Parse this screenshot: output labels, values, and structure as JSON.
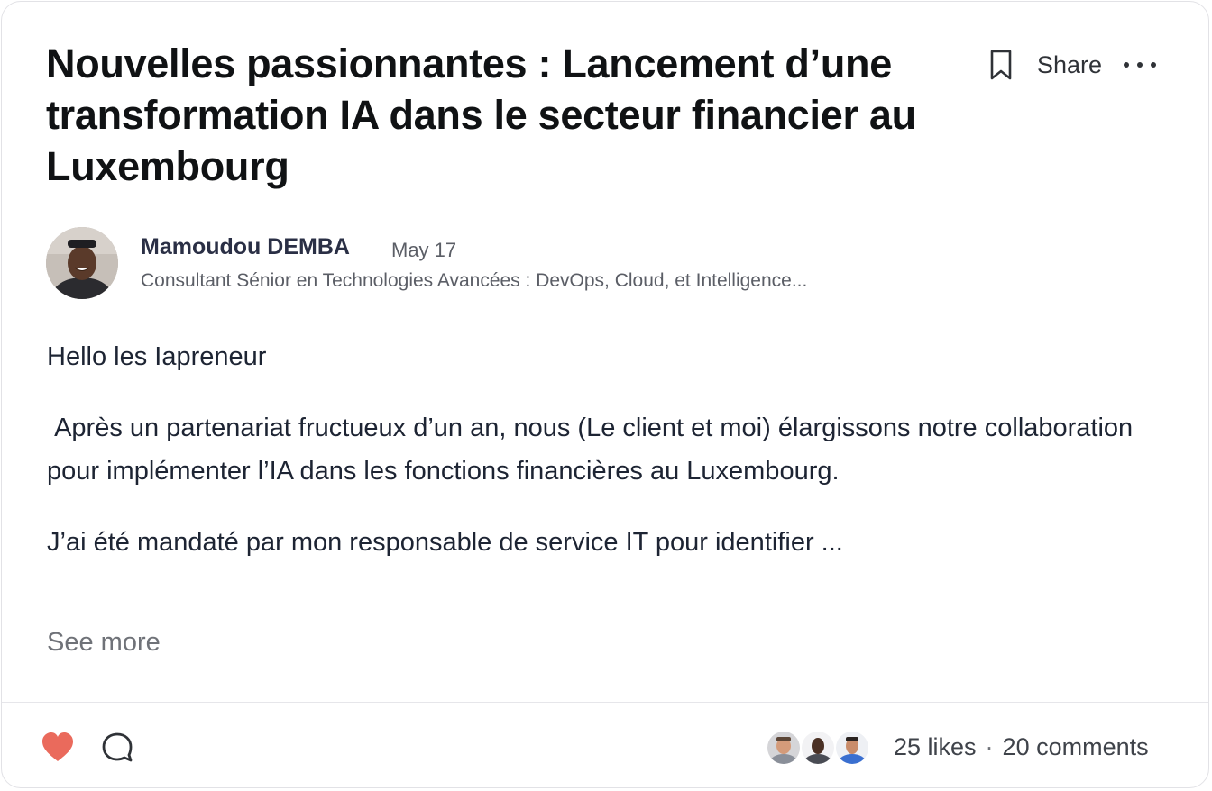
{
  "post": {
    "title": "Nouvelles passionnantes : Lancement d’une transformation IA dans le secteur financier au Luxembourg",
    "share_label": "Share",
    "author": {
      "name": "Mamoudou DEMBA",
      "date": "May 17",
      "headline": "Consultant Sénior en Technologies Avancées : DevOps, Cloud, et Intelligence..."
    },
    "body": [
      "Hello les Iapreneur",
      " Après un partenariat fructueux d’un an, nous (Le client et moi) élargissons notre collaboration pour implémenter l’IA dans les fonctions financières au Luxembourg.",
      "J’ai été mandaté par mon responsable de service IT pour identifier ..."
    ],
    "see_more_label": "See more"
  },
  "footer": {
    "likes_label": "25 likes",
    "separator": "·",
    "comments_label": "20 comments"
  },
  "icons": {
    "bookmark": "bookmark-icon",
    "more": "more-horizontal-icon",
    "heart": "heart-icon",
    "comment": "comment-bubble-icon"
  },
  "colors": {
    "heart": "#ea6a5c",
    "title": "#101214",
    "author_name": "#2a2f45",
    "muted_text": "#5b5e66"
  }
}
